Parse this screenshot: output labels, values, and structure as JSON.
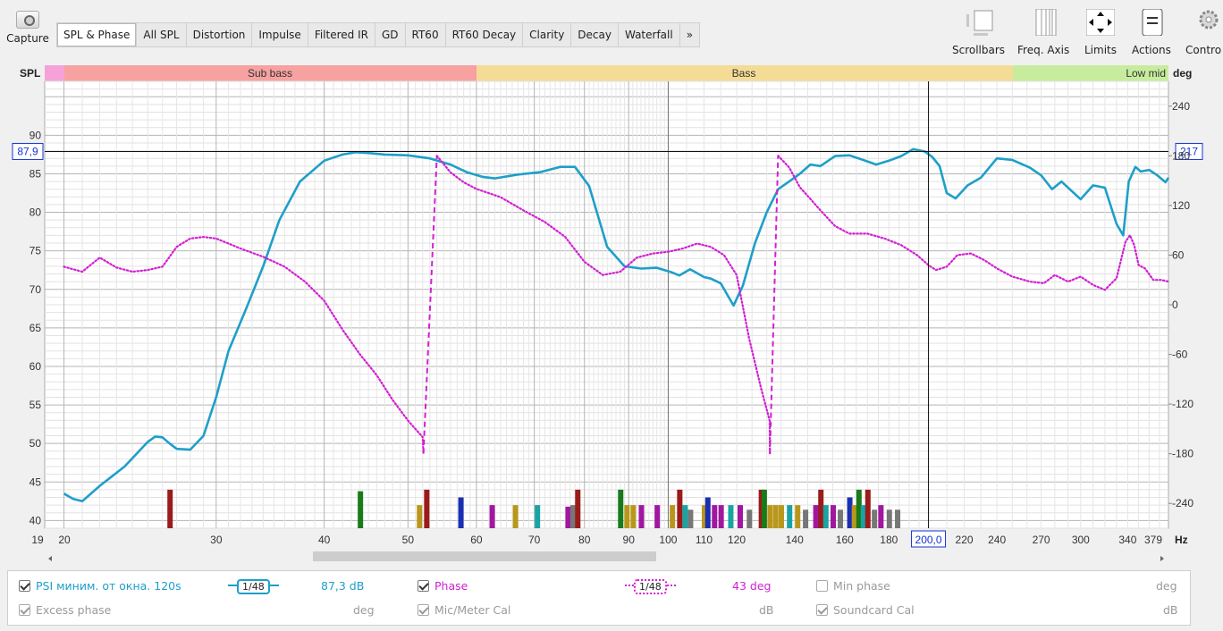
{
  "toolbar": {
    "capture_label": "Capture",
    "tabs": [
      "SPL & Phase",
      "All SPL",
      "Distortion",
      "Impulse",
      "Filtered IR",
      "GD",
      "RT60",
      "RT60 Decay",
      "Clarity",
      "Decay",
      "Waterfall",
      "»"
    ],
    "active_tab": "SPL & Phase",
    "tools": [
      "Scrollbars",
      "Freq. Axis",
      "Limits",
      "Actions",
      "Contro"
    ]
  },
  "bands": [
    {
      "label": "Sub bass",
      "color": "#f7a1a1"
    },
    {
      "label": "Bass",
      "color": "#f5dc96"
    },
    {
      "label": "Low mid",
      "color": "#c8ec9e"
    }
  ],
  "axes": {
    "left_unit": "SPL",
    "right_unit": "deg",
    "freq_unit": "Hz",
    "spl_ticks": [
      40,
      45,
      50,
      55,
      60,
      65,
      70,
      75,
      80,
      85,
      90
    ],
    "phase_ticks": [
      -240,
      -180,
      -120,
      -60,
      0,
      60,
      120,
      180,
      240
    ],
    "freq_ticks": [
      "19",
      "20",
      "30",
      "40",
      "50",
      "60",
      "70",
      "80",
      "90",
      "100",
      "110",
      "120",
      "140",
      "160",
      "180",
      "200,0",
      "220",
      "240",
      "270",
      "300",
      "340",
      "379"
    ],
    "cursor_spl": "87,9",
    "cursor_phase": "217",
    "cursor_freq": "200,0"
  },
  "chart_data": {
    "type": "line",
    "x_scale": "log",
    "xlim": [
      19,
      379
    ],
    "ylim_left": [
      39,
      97
    ],
    "ylim_right": [
      -270,
      270
    ],
    "cursor": {
      "freq": 200,
      "spl": 87.9
    },
    "series": [
      {
        "name": "PSI миним. от окна. 120s",
        "color": "#1e9fc9",
        "axis": "left",
        "x": [
          20,
          20.5,
          21,
          22,
          23.5,
          25,
          25.5,
          26,
          26.5,
          27,
          28,
          29,
          30,
          31,
          32.5,
          34,
          35.5,
          37.5,
          40,
          42,
          43.5,
          45,
          47,
          50,
          53,
          56,
          58.5,
          61,
          63,
          67,
          71,
          75,
          78,
          81,
          85,
          89,
          93,
          97,
          101,
          103,
          106,
          110,
          112,
          115,
          119,
          122,
          126,
          130,
          134,
          138,
          142,
          146,
          150,
          156,
          162,
          168,
          174,
          180,
          186,
          192,
          198,
          202,
          206,
          210,
          215,
          222,
          230,
          240,
          250,
          262,
          270,
          278,
          285,
          292,
          300,
          310,
          320,
          330,
          336,
          341,
          347,
          352,
          360,
          368,
          376,
          379
        ],
        "y": [
          43.5,
          42.8,
          42.5,
          44.5,
          47,
          50.2,
          50.9,
          50.8,
          50,
          49.3,
          49.2,
          51,
          56,
          62,
          67.5,
          73,
          79,
          84,
          86.7,
          87.5,
          87.8,
          87.7,
          87.5,
          87.4,
          87,
          86.2,
          85.2,
          84.6,
          84.4,
          84.9,
          85.2,
          85.9,
          85.9,
          83.4,
          75.5,
          73,
          72.7,
          72.8,
          72.2,
          71.8,
          72.6,
          71.6,
          71.4,
          70.8,
          67.9,
          70.5,
          76,
          80,
          83,
          84,
          85,
          86.2,
          86,
          87.3,
          87.4,
          86.8,
          86.2,
          86.7,
          87.3,
          88.2,
          87.9,
          87.2,
          86,
          82.5,
          81.8,
          83.5,
          84.5,
          87,
          86.8,
          85.8,
          84.8,
          83,
          84,
          82.9,
          81.7,
          83.5,
          83.2,
          78.5,
          77,
          84,
          85.9,
          85.3,
          85.5,
          84.8,
          83.9,
          84.5
        ]
      },
      {
        "name": "Phase",
        "color": "#d21fd2",
        "axis": "right",
        "x": [
          20,
          21,
          22,
          23,
          24,
          25,
          26,
          27,
          28,
          29,
          30,
          31,
          32,
          34,
          36,
          38,
          40,
          42,
          44,
          46,
          48,
          50,
          52,
          52.1,
          54,
          56,
          58,
          60,
          64,
          68,
          72,
          76,
          80,
          84,
          88,
          92,
          96,
          100,
          104,
          108,
          112,
          116,
          120,
          124,
          128,
          131,
          131.1,
          134,
          138,
          142,
          146,
          150,
          156,
          162,
          170,
          178,
          186,
          194,
          200,
          204,
          210,
          216,
          224,
          232,
          240,
          250,
          262,
          272,
          280,
          290,
          300,
          310,
          320,
          330,
          338,
          342,
          346,
          350,
          356,
          364,
          372,
          379
        ],
        "y": [
          46,
          40,
          57,
          45,
          40,
          42,
          46,
          70,
          80,
          82,
          80,
          74,
          68,
          58,
          46,
          28,
          5,
          -30,
          -60,
          -85,
          -115,
          -140,
          -160,
          -180,
          180,
          160,
          148,
          140,
          130,
          114,
          100,
          82,
          52,
          36,
          40,
          57,
          62,
          64,
          68,
          74,
          70,
          60,
          36,
          -40,
          -100,
          -140,
          -180,
          180,
          166,
          142,
          128,
          114,
          95,
          86,
          86,
          80,
          72,
          60,
          48,
          42,
          46,
          60,
          62,
          54,
          44,
          34,
          28,
          26,
          36,
          28,
          34,
          24,
          18,
          32,
          76,
          84,
          72,
          48,
          44,
          30,
          30,
          28
        ]
      }
    ],
    "markers": [
      {
        "f": 26.5,
        "c": "#9b1b1b",
        "h": 44
      },
      {
        "f": 44,
        "c": "#1a7a1a",
        "h": 43.8
      },
      {
        "f": 51.5,
        "c": "#b9971d",
        "h": 42
      },
      {
        "f": 52.5,
        "c": "#9b1b1b",
        "h": 44
      },
      {
        "f": 57.5,
        "c": "#1a2fb2",
        "h": 43
      },
      {
        "f": 62.5,
        "c": "#a018a0",
        "h": 42
      },
      {
        "f": 66.5,
        "c": "#b9971d",
        "h": 42
      },
      {
        "f": 70.5,
        "c": "#1aa3a3",
        "h": 42
      },
      {
        "f": 76.5,
        "c": "#a018a0",
        "h": 41.8
      },
      {
        "f": 77.5,
        "c": "#777777",
        "h": 42
      },
      {
        "f": 78.5,
        "c": "#9b1b1b",
        "h": 44
      },
      {
        "f": 88,
        "c": "#1a7a1a",
        "h": 44
      },
      {
        "f": 89.5,
        "c": "#b9971d",
        "h": 42
      },
      {
        "f": 91,
        "c": "#b9971d",
        "h": 42
      },
      {
        "f": 93,
        "c": "#a018a0",
        "h": 42
      },
      {
        "f": 97,
        "c": "#a018a0",
        "h": 42
      },
      {
        "f": 101,
        "c": "#b9971d",
        "h": 42
      },
      {
        "f": 103,
        "c": "#9b1b1b",
        "h": 44
      },
      {
        "f": 104.5,
        "c": "#1aa3a3",
        "h": 42
      },
      {
        "f": 106,
        "c": "#777777",
        "h": 41.4
      },
      {
        "f": 110,
        "c": "#b9971d",
        "h": 42
      },
      {
        "f": 111,
        "c": "#1a2fb2",
        "h": 43
      },
      {
        "f": 113,
        "c": "#a018a0",
        "h": 42
      },
      {
        "f": 115,
        "c": "#a018a0",
        "h": 42
      },
      {
        "f": 118,
        "c": "#1aa3a3",
        "h": 42
      },
      {
        "f": 121,
        "c": "#a018a0",
        "h": 42
      },
      {
        "f": 124,
        "c": "#777777",
        "h": 41.4
      },
      {
        "f": 128,
        "c": "#9b1b1b",
        "h": 44
      },
      {
        "f": 129,
        "c": "#1a7a1a",
        "h": 44
      },
      {
        "f": 131,
        "c": "#b9971d",
        "h": 42
      },
      {
        "f": 133,
        "c": "#b9971d",
        "h": 42
      },
      {
        "f": 135,
        "c": "#b9971d",
        "h": 42
      },
      {
        "f": 138,
        "c": "#1aa3a3",
        "h": 42
      },
      {
        "f": 141,
        "c": "#b9971d",
        "h": 42
      },
      {
        "f": 144,
        "c": "#777777",
        "h": 41.4
      },
      {
        "f": 148,
        "c": "#a018a0",
        "h": 42
      },
      {
        "f": 150,
        "c": "#9b1b1b",
        "h": 44
      },
      {
        "f": 152,
        "c": "#1aa3a3",
        "h": 42
      },
      {
        "f": 155,
        "c": "#a018a0",
        "h": 42
      },
      {
        "f": 158,
        "c": "#777777",
        "h": 41.4
      },
      {
        "f": 162,
        "c": "#1a2fb2",
        "h": 43
      },
      {
        "f": 164,
        "c": "#b9971d",
        "h": 42
      },
      {
        "f": 166,
        "c": "#1a7a1a",
        "h": 44
      },
      {
        "f": 168,
        "c": "#1aa3a3",
        "h": 42
      },
      {
        "f": 170,
        "c": "#9b1b1b",
        "h": 44
      },
      {
        "f": 173,
        "c": "#777777",
        "h": 41.4
      },
      {
        "f": 176,
        "c": "#a018a0",
        "h": 42
      },
      {
        "f": 180,
        "c": "#777777",
        "h": 41.4
      },
      {
        "f": 184,
        "c": "#777777",
        "h": 41.4
      }
    ]
  },
  "legend": {
    "row1": [
      {
        "label": "PSI миним. от окна. 120s",
        "checked": true,
        "smooth": "1/48",
        "value": "87,3 dB"
      },
      {
        "label": "Phase",
        "checked": true,
        "smooth": "1/48",
        "value": "43 deg"
      },
      {
        "label": "Min phase",
        "checked": false,
        "value": "deg"
      }
    ],
    "row2": [
      {
        "label": "Excess phase",
        "checked": true,
        "value": "deg"
      },
      {
        "label": "Mic/Meter Cal",
        "checked": true,
        "value": "dB"
      },
      {
        "label": "Soundcard Cal",
        "checked": true,
        "value": "dB"
      }
    ]
  }
}
